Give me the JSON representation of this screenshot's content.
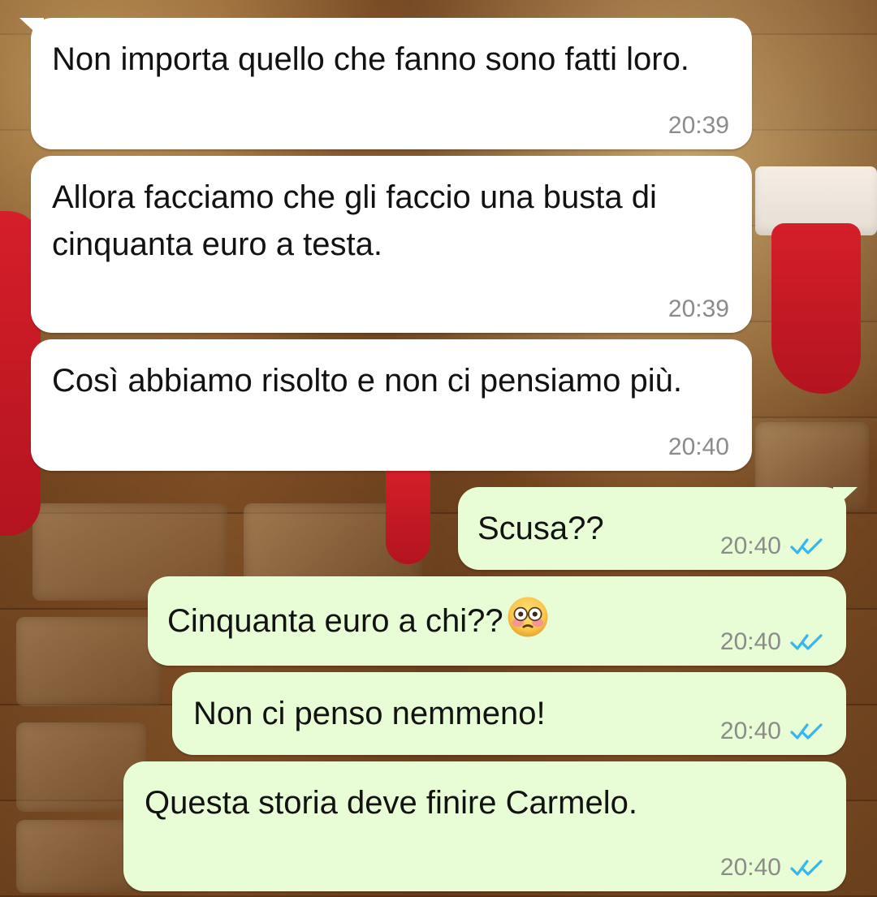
{
  "messages": [
    {
      "id": "m1",
      "direction": "incoming",
      "text": "Non importa quello che fanno sono fatti loro.",
      "time": "20:39"
    },
    {
      "id": "m2",
      "direction": "incoming",
      "text": "Allora facciamo che gli faccio una busta di cinquanta euro a testa.",
      "time": "20:39"
    },
    {
      "id": "m3",
      "direction": "incoming",
      "text": "Così abbiamo risolto e non ci pensiamo più.",
      "time": "20:40"
    },
    {
      "id": "m4",
      "direction": "outgoing",
      "text": "Scusa??",
      "time": "20:40",
      "status": "read"
    },
    {
      "id": "m5",
      "direction": "outgoing",
      "text": "Cinquanta euro a chi??",
      "emoji": "flushed-face-emoji",
      "time": "20:40",
      "status": "read"
    },
    {
      "id": "m6",
      "direction": "outgoing",
      "text": "Non ci penso nemmeno!",
      "time": "20:40",
      "status": "read"
    },
    {
      "id": "m7",
      "direction": "outgoing",
      "text": "Questa storia deve finire Carmelo.",
      "time": "20:40",
      "status": "read"
    }
  ],
  "colors": {
    "incoming_bubble": "#ffffff",
    "outgoing_bubble": "#e8fdd6",
    "timestamp": "#8b8b8b",
    "read_ticks": "#34b7f1"
  }
}
